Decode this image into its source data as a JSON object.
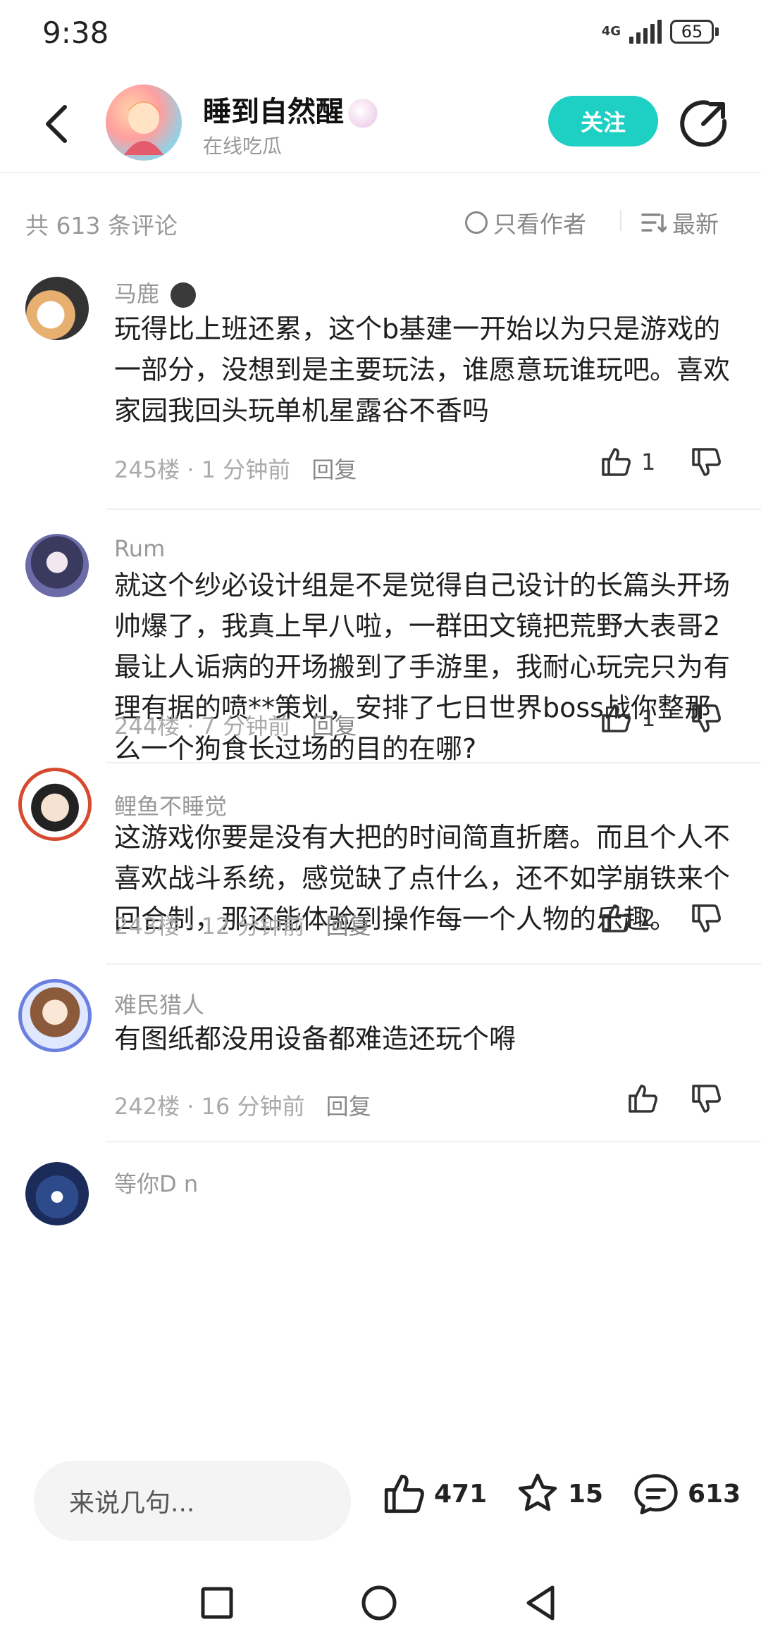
{
  "status_bar": {
    "time": "9:38",
    "network": "4G",
    "battery": "65"
  },
  "header": {
    "author_name": "睡到自然醒",
    "author_subtitle": "在线吃瓜",
    "follow_label": "关注"
  },
  "comment_bar": {
    "count_label": "共 613 条评论",
    "author_only_label": "只看作者",
    "sort_label": "最新"
  },
  "comments": [
    {
      "name": "马鹿",
      "text": "玩得比上班还累，这个b基建一开始以为只是游戏的一部分，没想到是主要玩法，谁愿意玩谁玩吧。喜欢家园我回头玩单机星露谷不香吗",
      "floor": "245楼 · 1 分钟前",
      "reply_label": "回复",
      "likes": "1"
    },
    {
      "name": "Rum",
      "text": "就这个纱必设计组是不是觉得自己设计的长篇头开场帅爆了，我真上早八啦，一群田文镜把荒野大表哥2最让人诟病的开场搬到了手游里，我耐心玩完只为有理有据的喷**策划，安排了七日世界boss战你整那么一个狗食长过场的目的在哪?",
      "floor": "244楼 · 7 分钟前",
      "reply_label": "回复",
      "likes": "1"
    },
    {
      "name": "鲤鱼不睡觉",
      "text": "这游戏你要是没有大把的时间简直折磨。而且个人不喜欢战斗系统，感觉缺了点什么，还不如学崩铁来个回合制，那还能体验到操作每一个人物的乐趣。",
      "floor": "243楼 · 12 分钟前",
      "reply_label": "回复",
      "likes": "2"
    },
    {
      "name": "难民猎人",
      "text": "有图纸都没用设备都难造还玩个嘚",
      "floor": "242楼 · 16 分钟前",
      "reply_label": "回复",
      "likes": ""
    },
    {
      "name": "等你D n",
      "text": "",
      "floor": "",
      "reply_label": "",
      "likes": ""
    }
  ],
  "bottom_bar": {
    "input_placeholder": "来说几句...",
    "like_count": "471",
    "star_count": "15",
    "comment_count": "613"
  },
  "colors": {
    "accent": "#1ecfc3",
    "muted": "#999999"
  },
  "icons": [
    "back-arrow-icon",
    "share-icon",
    "radio-icon",
    "sort-icon",
    "thumbs-up-icon",
    "thumbs-down-icon",
    "star-icon",
    "comment-icon",
    "square-icon",
    "circle-icon",
    "triangle-back-icon"
  ]
}
